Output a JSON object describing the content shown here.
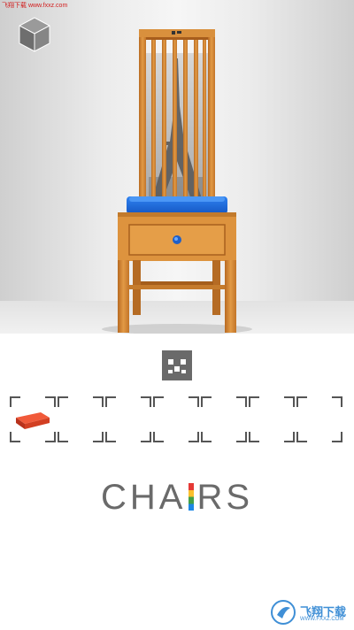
{
  "watermark_top": "飞翔下载 www.fxxz.com",
  "logo": {
    "part1": "CHA",
    "part2": "RS"
  },
  "slots": [
    {
      "item": "red-tile"
    },
    {
      "item": null
    },
    {
      "item": null
    },
    {
      "item": null
    },
    {
      "item": null
    },
    {
      "item": null
    },
    {
      "item": null
    }
  ],
  "watermark_bottom": {
    "text": "飞翔下载",
    "sub": "WWW.FXXZ.COM"
  },
  "colors": {
    "wood": "#d98a34",
    "cushion": "#1f6fe0",
    "inventory_item": "#e8442a",
    "slot_bracket": "#555555"
  }
}
